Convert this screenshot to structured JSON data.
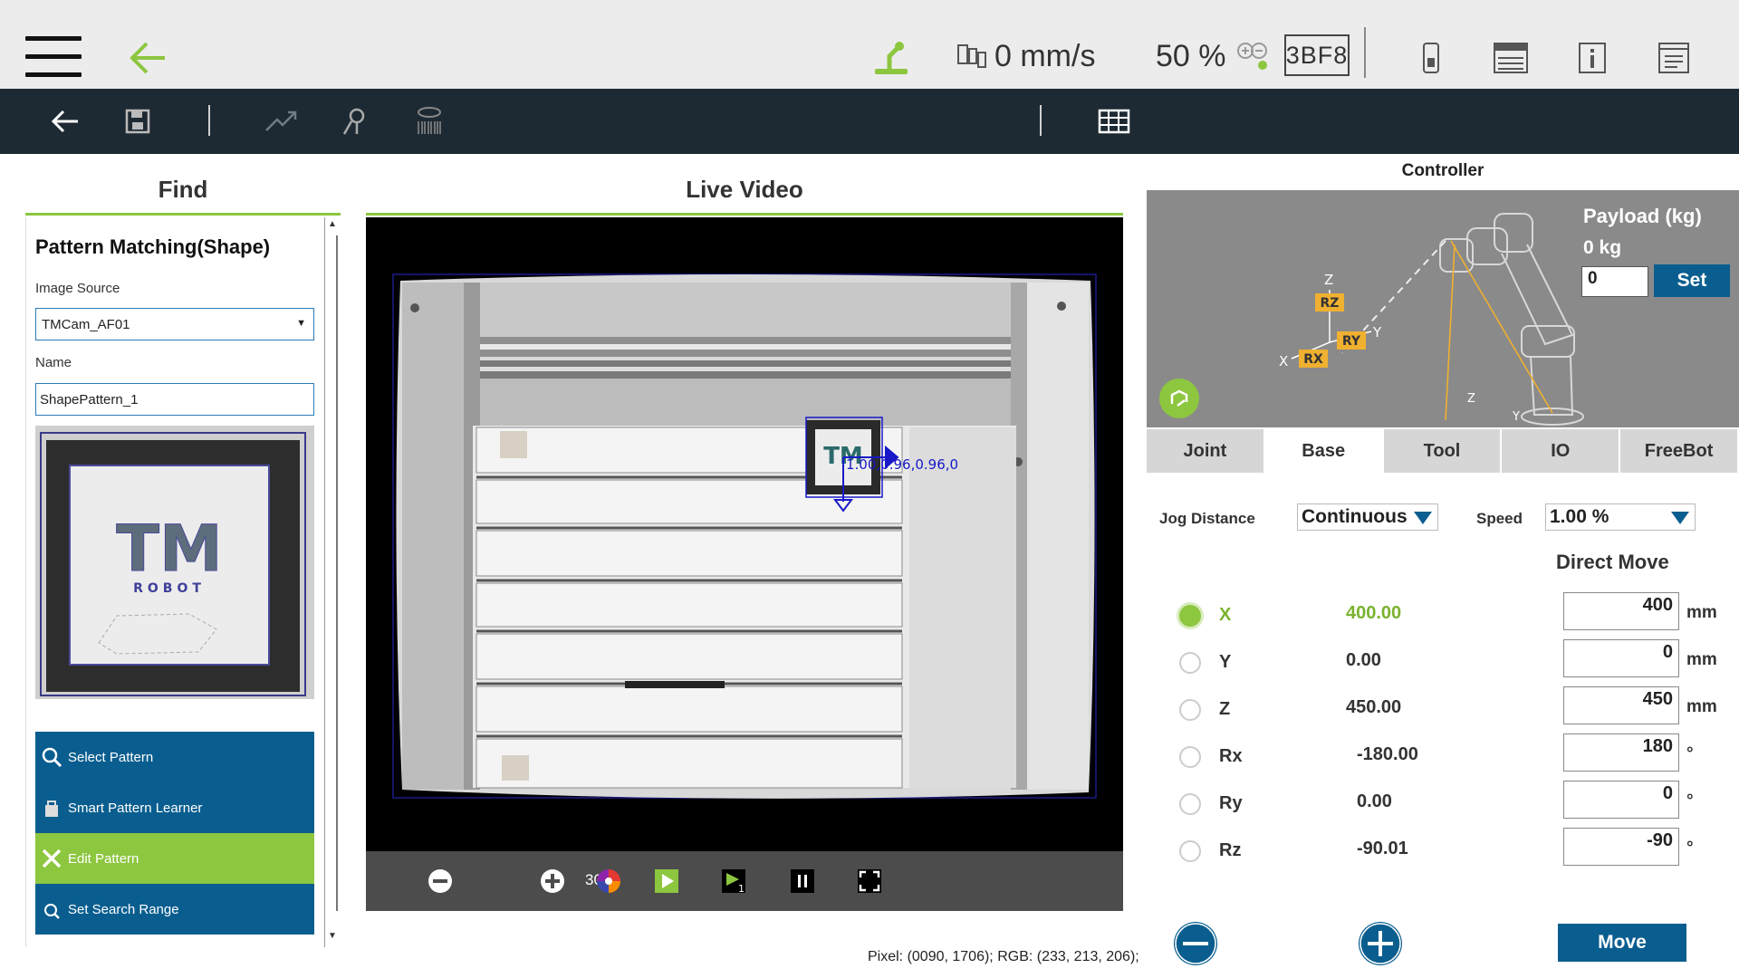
{
  "topbar": {
    "speed": "0 mm/s",
    "percent": "50 %",
    "code": "3BF8"
  },
  "find": {
    "header": "Find",
    "section_title": "Pattern Matching(Shape)",
    "image_source_label": "Image Source",
    "image_source_value": "TMCam_AF01",
    "name_label": "Name",
    "name_value": "ShapePattern_1",
    "thumb_logo_text": "TM",
    "thumb_sub_text": "ROBOT",
    "buttons": [
      "Select Pattern",
      "Smart Pattern Learner",
      "Edit Pattern",
      "Set Search Range"
    ]
  },
  "video": {
    "header": "Live Video",
    "zoom": "30%",
    "match_label": "1.00,0.96,0.96,0",
    "pixel_info": "Pixel: (0090, 1706); RGB: (233, 213, 206);"
  },
  "controller": {
    "title": "Controller",
    "payload_label": "Payload (kg)",
    "payload_value": "0 kg",
    "payload_input": "0",
    "set_label": "Set",
    "axis_labels": {
      "z": "Z",
      "x": "X",
      "y": "Y",
      "rz": "RZ",
      "ry": "RY",
      "rx": "RX"
    },
    "tabs": [
      "Joint",
      "Base",
      "Tool",
      "IO",
      "FreeBot"
    ],
    "active_tab": "Base",
    "jog_distance_label": "Jog Distance",
    "jog_distance_value": "Continuous",
    "speed_label": "Speed",
    "speed_value": "1.00 %",
    "direct_move_title": "Direct Move",
    "axes": [
      {
        "name": "X",
        "value": "400.00",
        "input": "400",
        "unit": "mm",
        "selected": true
      },
      {
        "name": "Y",
        "value": "0.00",
        "input": "0",
        "unit": "mm",
        "selected": false
      },
      {
        "name": "Z",
        "value": "450.00",
        "input": "450",
        "unit": "mm",
        "selected": false
      },
      {
        "name": "Rx",
        "value": "-180.00",
        "input": "180",
        "unit": "°",
        "selected": false
      },
      {
        "name": "Ry",
        "value": "0.00",
        "input": "0",
        "unit": "°",
        "selected": false
      },
      {
        "name": "Rz",
        "value": "-90.01",
        "input": "-90",
        "unit": "°",
        "selected": false
      }
    ],
    "move_label": "Move"
  },
  "colors": {
    "accent_green": "#8dc63f",
    "brand_blue": "#0a5e8f",
    "toolbar_dark": "#1e2a33"
  }
}
